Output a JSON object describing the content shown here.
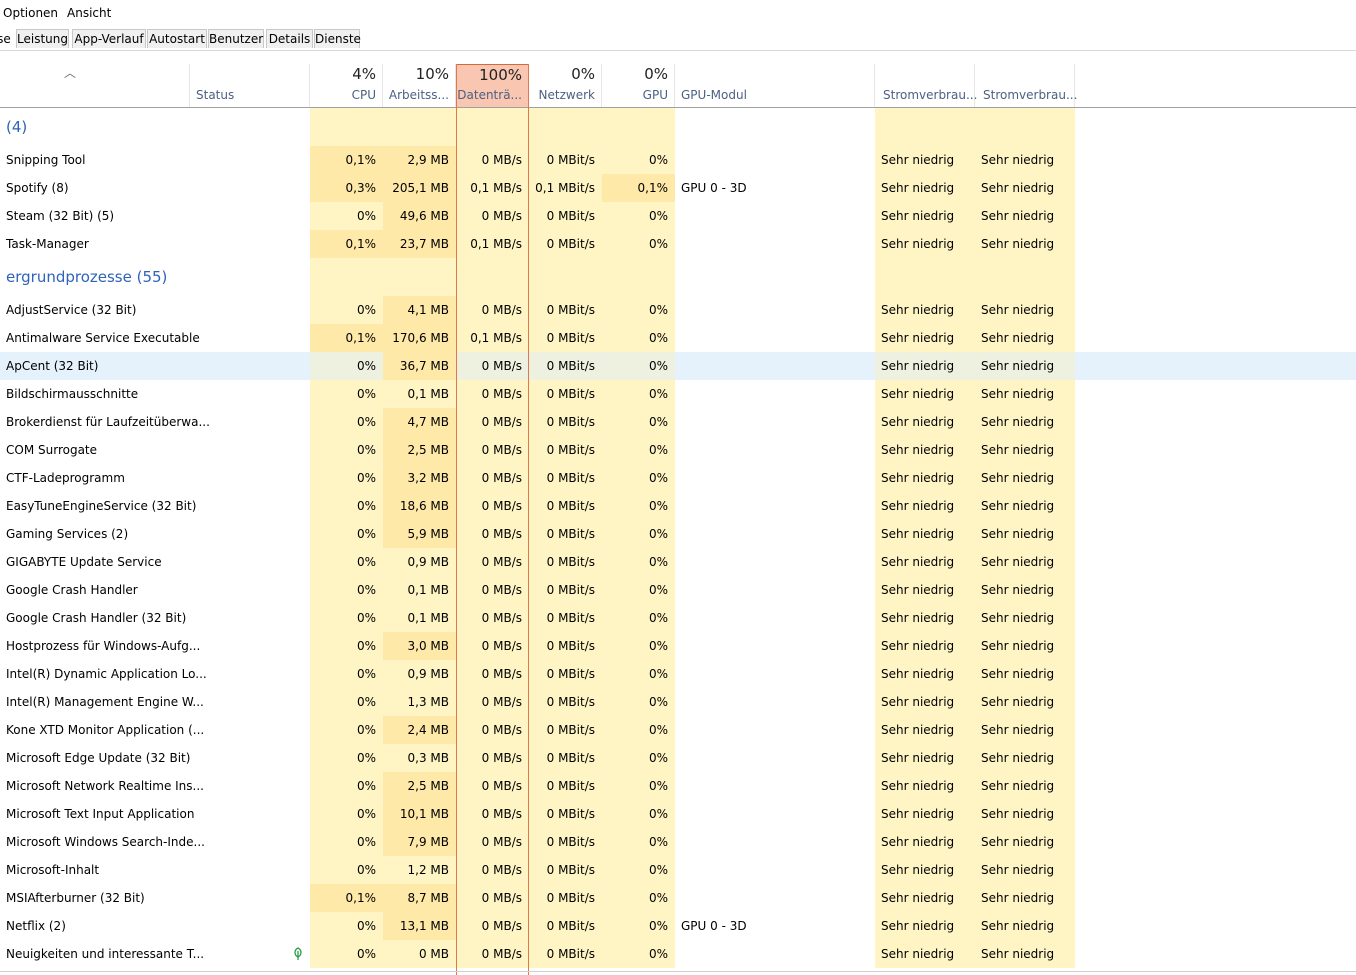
{
  "menu": {
    "items": [
      "Optionen",
      "Ansicht"
    ]
  },
  "tabs": [
    "se",
    "Leistung",
    "App-Verlauf",
    "Autostart",
    "Benutzer",
    "Details",
    "Dienste"
  ],
  "columns": {
    "status": "Status",
    "cpu": {
      "pct": "4%",
      "title": "CPU"
    },
    "mem": {
      "pct": "10%",
      "title": "Arbeitss..."
    },
    "disk": {
      "pct": "100%",
      "title": "Datenträ..."
    },
    "net": {
      "pct": "0%",
      "title": "Netzwerk"
    },
    "gpu": {
      "pct": "0%",
      "title": "GPU"
    },
    "gpumod": "GPU-Modul",
    "power": "Stromverbrau...",
    "power_trend": "Stromverbrau..."
  },
  "groups": {
    "apps": "(4)",
    "background": "ergrundprozesse (55)"
  },
  "apps": [
    {
      "name": "Snipping Tool",
      "cpu": "0,1%",
      "mem": "2,9 MB",
      "disk": "0 MB/s",
      "net": "0 MBit/s",
      "gpu": "0%",
      "gpumod": "",
      "p1": "Sehr niedrig",
      "p2": "Sehr niedrig"
    },
    {
      "name": "Spotify (8)",
      "cpu": "0,3%",
      "mem": "205,1 MB",
      "disk": "0,1 MB/s",
      "net": "0,1 MBit/s",
      "gpu": "0,1%",
      "gpumod": "GPU 0 - 3D",
      "p1": "Sehr niedrig",
      "p2": "Sehr niedrig"
    },
    {
      "name": "Steam (32 Bit) (5)",
      "cpu": "0%",
      "mem": "49,6 MB",
      "disk": "0 MB/s",
      "net": "0 MBit/s",
      "gpu": "0%",
      "gpumod": "",
      "p1": "Sehr niedrig",
      "p2": "Sehr niedrig"
    },
    {
      "name": "Task-Manager",
      "cpu": "0,1%",
      "mem": "23,7 MB",
      "disk": "0,1 MB/s",
      "net": "0 MBit/s",
      "gpu": "0%",
      "gpumod": "",
      "p1": "Sehr niedrig",
      "p2": "Sehr niedrig"
    }
  ],
  "background": [
    {
      "name": "AdjustService (32 Bit)",
      "cpu": "0%",
      "mem": "4,1 MB",
      "disk": "0 MB/s",
      "net": "0 MBit/s",
      "gpu": "0%",
      "gpumod": "",
      "p1": "Sehr niedrig",
      "p2": "Sehr niedrig"
    },
    {
      "name": "Antimalware Service Executable",
      "cpu": "0,1%",
      "mem": "170,6 MB",
      "disk": "0,1 MB/s",
      "net": "0 MBit/s",
      "gpu": "0%",
      "gpumod": "",
      "p1": "Sehr niedrig",
      "p2": "Sehr niedrig"
    },
    {
      "name": "ApCent (32 Bit)",
      "cpu": "0%",
      "mem": "36,7 MB",
      "disk": "0 MB/s",
      "net": "0 MBit/s",
      "gpu": "0%",
      "gpumod": "",
      "p1": "Sehr niedrig",
      "p2": "Sehr niedrig",
      "selected": true
    },
    {
      "name": "Bildschirmausschnitte",
      "cpu": "0%",
      "mem": "0,1 MB",
      "disk": "0 MB/s",
      "net": "0 MBit/s",
      "gpu": "0%",
      "gpumod": "",
      "p1": "Sehr niedrig",
      "p2": "Sehr niedrig"
    },
    {
      "name": "Brokerdienst für Laufzeitüberwa...",
      "cpu": "0%",
      "mem": "4,7 MB",
      "disk": "0 MB/s",
      "net": "0 MBit/s",
      "gpu": "0%",
      "gpumod": "",
      "p1": "Sehr niedrig",
      "p2": "Sehr niedrig"
    },
    {
      "name": "COM Surrogate",
      "cpu": "0%",
      "mem": "2,5 MB",
      "disk": "0 MB/s",
      "net": "0 MBit/s",
      "gpu": "0%",
      "gpumod": "",
      "p1": "Sehr niedrig",
      "p2": "Sehr niedrig"
    },
    {
      "name": "CTF-Ladeprogramm",
      "cpu": "0%",
      "mem": "3,2 MB",
      "disk": "0 MB/s",
      "net": "0 MBit/s",
      "gpu": "0%",
      "gpumod": "",
      "p1": "Sehr niedrig",
      "p2": "Sehr niedrig"
    },
    {
      "name": "EasyTuneEngineService (32 Bit)",
      "cpu": "0%",
      "mem": "18,6 MB",
      "disk": "0 MB/s",
      "net": "0 MBit/s",
      "gpu": "0%",
      "gpumod": "",
      "p1": "Sehr niedrig",
      "p2": "Sehr niedrig"
    },
    {
      "name": "Gaming Services (2)",
      "cpu": "0%",
      "mem": "5,9 MB",
      "disk": "0 MB/s",
      "net": "0 MBit/s",
      "gpu": "0%",
      "gpumod": "",
      "p1": "Sehr niedrig",
      "p2": "Sehr niedrig"
    },
    {
      "name": "GIGABYTE Update Service",
      "cpu": "0%",
      "mem": "0,9 MB",
      "disk": "0 MB/s",
      "net": "0 MBit/s",
      "gpu": "0%",
      "gpumod": "",
      "p1": "Sehr niedrig",
      "p2": "Sehr niedrig"
    },
    {
      "name": "Google Crash Handler",
      "cpu": "0%",
      "mem": "0,1 MB",
      "disk": "0 MB/s",
      "net": "0 MBit/s",
      "gpu": "0%",
      "gpumod": "",
      "p1": "Sehr niedrig",
      "p2": "Sehr niedrig"
    },
    {
      "name": "Google Crash Handler (32 Bit)",
      "cpu": "0%",
      "mem": "0,1 MB",
      "disk": "0 MB/s",
      "net": "0 MBit/s",
      "gpu": "0%",
      "gpumod": "",
      "p1": "Sehr niedrig",
      "p2": "Sehr niedrig"
    },
    {
      "name": "Hostprozess für Windows-Aufg...",
      "cpu": "0%",
      "mem": "3,0 MB",
      "disk": "0 MB/s",
      "net": "0 MBit/s",
      "gpu": "0%",
      "gpumod": "",
      "p1": "Sehr niedrig",
      "p2": "Sehr niedrig"
    },
    {
      "name": "Intel(R) Dynamic Application Lo...",
      "cpu": "0%",
      "mem": "0,9 MB",
      "disk": "0 MB/s",
      "net": "0 MBit/s",
      "gpu": "0%",
      "gpumod": "",
      "p1": "Sehr niedrig",
      "p2": "Sehr niedrig"
    },
    {
      "name": "Intel(R) Management Engine W...",
      "cpu": "0%",
      "mem": "1,3 MB",
      "disk": "0 MB/s",
      "net": "0 MBit/s",
      "gpu": "0%",
      "gpumod": "",
      "p1": "Sehr niedrig",
      "p2": "Sehr niedrig"
    },
    {
      "name": "Kone XTD Monitor Application (...",
      "cpu": "0%",
      "mem": "2,4 MB",
      "disk": "0 MB/s",
      "net": "0 MBit/s",
      "gpu": "0%",
      "gpumod": "",
      "p1": "Sehr niedrig",
      "p2": "Sehr niedrig"
    },
    {
      "name": "Microsoft Edge Update (32 Bit)",
      "cpu": "0%",
      "mem": "0,3 MB",
      "disk": "0 MB/s",
      "net": "0 MBit/s",
      "gpu": "0%",
      "gpumod": "",
      "p1": "Sehr niedrig",
      "p2": "Sehr niedrig"
    },
    {
      "name": "Microsoft Network Realtime Ins...",
      "cpu": "0%",
      "mem": "2,5 MB",
      "disk": "0 MB/s",
      "net": "0 MBit/s",
      "gpu": "0%",
      "gpumod": "",
      "p1": "Sehr niedrig",
      "p2": "Sehr niedrig"
    },
    {
      "name": "Microsoft Text Input Application",
      "cpu": "0%",
      "mem": "10,1 MB",
      "disk": "0 MB/s",
      "net": "0 MBit/s",
      "gpu": "0%",
      "gpumod": "",
      "p1": "Sehr niedrig",
      "p2": "Sehr niedrig"
    },
    {
      "name": "Microsoft Windows Search-Inde...",
      "cpu": "0%",
      "mem": "7,9 MB",
      "disk": "0 MB/s",
      "net": "0 MBit/s",
      "gpu": "0%",
      "gpumod": "",
      "p1": "Sehr niedrig",
      "p2": "Sehr niedrig"
    },
    {
      "name": "Microsoft-Inhalt",
      "cpu": "0%",
      "mem": "1,2 MB",
      "disk": "0 MB/s",
      "net": "0 MBit/s",
      "gpu": "0%",
      "gpumod": "",
      "p1": "Sehr niedrig",
      "p2": "Sehr niedrig"
    },
    {
      "name": "MSIAfterburner (32 Bit)",
      "cpu": "0,1%",
      "mem": "8,7 MB",
      "disk": "0 MB/s",
      "net": "0 MBit/s",
      "gpu": "0%",
      "gpumod": "",
      "p1": "Sehr niedrig",
      "p2": "Sehr niedrig"
    },
    {
      "name": "Netflix (2)",
      "cpu": "0%",
      "mem": "13,1 MB",
      "disk": "0 MB/s",
      "net": "0 MBit/s",
      "gpu": "0%",
      "gpumod": "GPU 0 - 3D",
      "p1": "Sehr niedrig",
      "p2": "Sehr niedrig"
    },
    {
      "name": "Neuigkeiten und interessante T...",
      "cpu": "0%",
      "mem": "0 MB",
      "disk": "0 MB/s",
      "net": "0 MBit/s",
      "gpu": "0%",
      "gpumod": "",
      "p1": "Sehr niedrig",
      "p2": "Sehr niedrig",
      "icon": "leaf-icon"
    }
  ],
  "colors": {
    "heat_low": "#fff4c4",
    "heat_med": "#ffe9a8",
    "disk_header": "#f9c6b1",
    "disk_border": "#e0784c",
    "group_text": "#2e63b8",
    "selected_row": "#e5f1fb"
  }
}
